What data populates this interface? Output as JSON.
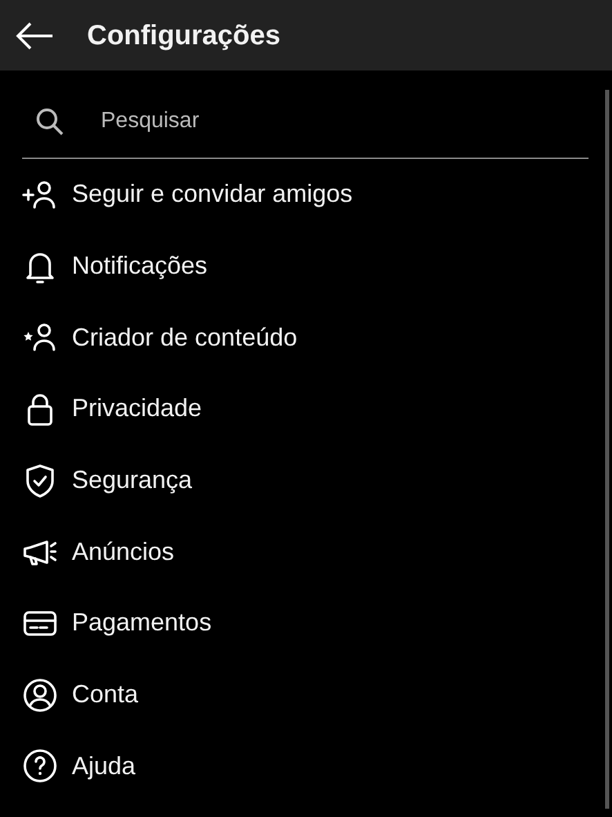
{
  "header": {
    "title": "Configurações"
  },
  "search": {
    "placeholder": "Pesquisar"
  },
  "items": [
    {
      "label": "Seguir e convidar amigos"
    },
    {
      "label": "Notificações"
    },
    {
      "label": "Criador de conteúdo"
    },
    {
      "label": "Privacidade"
    },
    {
      "label": "Segurança"
    },
    {
      "label": "Anúncios"
    },
    {
      "label": "Pagamentos"
    },
    {
      "label": "Conta"
    },
    {
      "label": "Ajuda"
    }
  ]
}
